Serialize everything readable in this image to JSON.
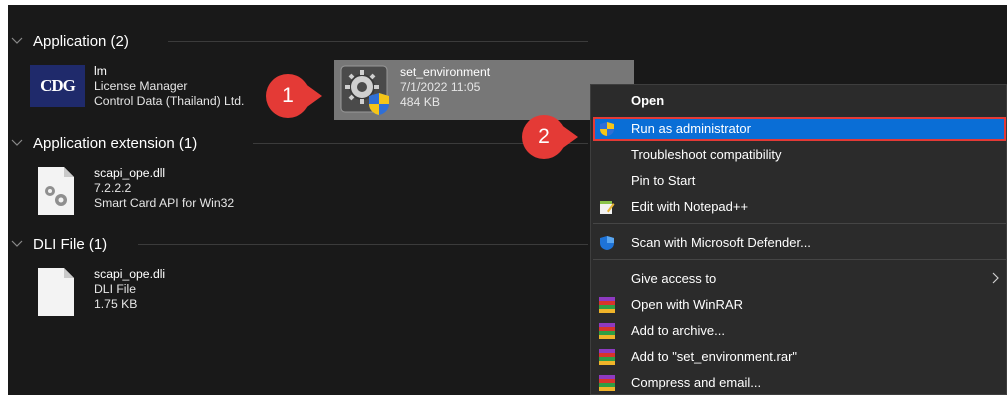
{
  "groups": [
    {
      "label": "Application (2)"
    },
    {
      "label": "Application extension (1)"
    },
    {
      "label": "DLI File (1)"
    }
  ],
  "items": {
    "lm": {
      "name": "lm",
      "line2": "License Manager",
      "line3": "Control Data (Thailand) Ltd."
    },
    "cdg_logo_text": "CDG",
    "set_env": {
      "name": "set_environment",
      "line2": "7/1/2022 11:05",
      "line3": "484 KB"
    },
    "scapi_dll": {
      "name": "scapi_ope.dll",
      "line2": "7.2.2.2",
      "line3": "Smart Card API for Win32"
    },
    "scapi_dli": {
      "name": "scapi_ope.dli",
      "line2": "DLI File",
      "line3": "1.75 KB"
    }
  },
  "callouts": [
    {
      "label": "1"
    },
    {
      "label": "2"
    }
  ],
  "context_menu": {
    "open": "Open",
    "run_as_admin": "Run as administrator",
    "troubleshoot": "Troubleshoot compatibility",
    "pin_start": "Pin to Start",
    "edit_notepad": "Edit with Notepad++",
    "scan_defender": "Scan with Microsoft Defender...",
    "give_access": "Give access to",
    "open_winrar": "Open with WinRAR",
    "add_archive": "Add to archive...",
    "add_rar": "Add to \"set_environment.rar\"",
    "compress_email": "Compress and email..."
  },
  "colors": {
    "explorer_bg": "#191919",
    "selected_item": "#777777",
    "menu_bg": "#2b2b2b",
    "highlight": "#0a6ed6",
    "callout": "#e43a36"
  },
  "icons": [
    "chevron-down-icon",
    "settings-app-icon",
    "uac-shield-icon",
    "dll-gear-icon",
    "blank-file-icon",
    "notepad-icon",
    "defender-shield-icon",
    "chevron-right-icon",
    "winrar-icon"
  ]
}
